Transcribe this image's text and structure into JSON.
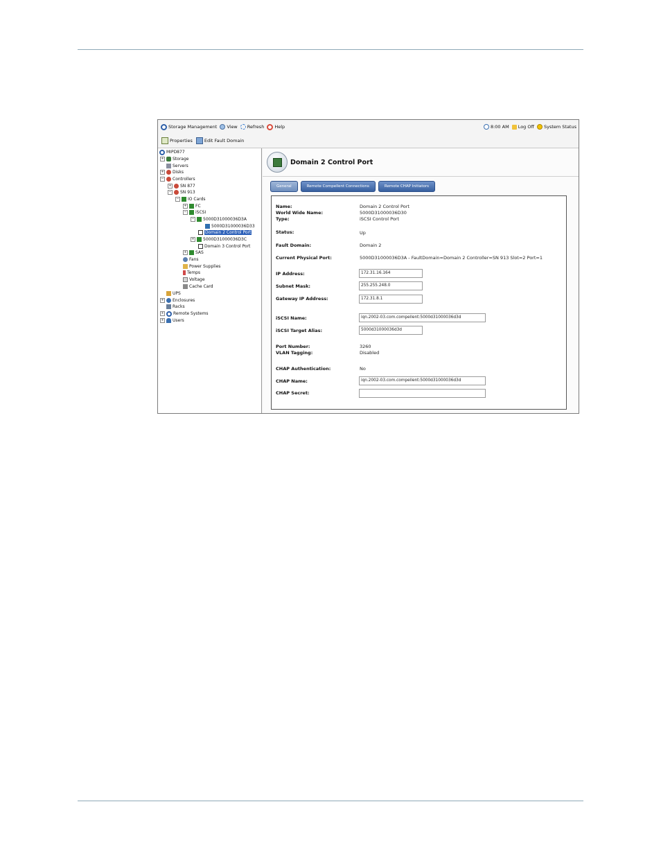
{
  "menubar": {
    "storage_management": "Storage Management",
    "view": "View",
    "refresh": "Refresh",
    "help": "Help",
    "time": "8:00 AM",
    "log_off": "Log Off",
    "system_status": "System Status"
  },
  "toolbar": {
    "properties": "Properties",
    "edit_fault_domain": "Edit Fault Domain"
  },
  "tree": {
    "root": "MIPD877",
    "storage": "Storage",
    "servers": "Servers",
    "disks": "Disks",
    "controllers": "Controllers",
    "sn877": "SN 877",
    "sn913": "SN 913",
    "io_cards": "IO Cards",
    "fc": "FC",
    "iscsi": "iSCSI",
    "port_3a": "5000D31000036D3A",
    "port_33": "5000D31000036D33",
    "domain2": "Domain 2 Control Port",
    "port_3c": "5000D31000036D3C",
    "domain3": "Domain 3 Control Port",
    "sas": "SAS",
    "fans": "Fans",
    "power_supplies": "Power Supplies",
    "temps": "Temps",
    "voltage": "Voltage",
    "cache_card": "Cache Card",
    "ups": "UPS",
    "enclosures": "Enclosures",
    "racks": "Racks",
    "remote_systems": "Remote Systems",
    "users": "Users"
  },
  "detail": {
    "title": "Domain 2 Control Port",
    "tabs": {
      "general": "General",
      "remote_connections": "Remote Compellent Connections",
      "remote_chap": "Remote CHAP Initiators"
    },
    "labels": {
      "name": "Name:",
      "wwn": "World Wide Name:",
      "type": "Type:",
      "status": "Status:",
      "fault_domain": "Fault Domain:",
      "physical_port": "Current Physical Port:",
      "ip": "IP Address:",
      "subnet": "Subnet Mask:",
      "gateway": "Gateway IP Address:",
      "iscsi_name": "iSCSI Name:",
      "iscsi_alias": "iSCSI Target Alias:",
      "port_number": "Port Number:",
      "vlan": "VLAN Tagging:",
      "chap_auth": "CHAP Authentication:",
      "chap_name": "CHAP Name:",
      "chap_secret": "CHAP Secret:"
    },
    "values": {
      "name": "Domain 2 Control Port",
      "wwn": "5000D31000036D30",
      "type": "iSCSI Control Port",
      "status": "Up",
      "fault_domain": "Domain 2",
      "physical_port": "5000D31000036D3A - FaultDomain=Domain 2 Controller=SN 913 Slot=2 Port=1",
      "ip": "172.31.16.164",
      "subnet": "255.255.248.0",
      "gateway": "172.31.8.1",
      "iscsi_name": "iqn.2002-03.com.compellent:5000d31000036d3d",
      "iscsi_alias": "5000d31000036d3d",
      "port_number": "3260",
      "vlan": "Disabled",
      "chap_auth": "No",
      "chap_name": "iqn.2002-03.com.compellent:5000d31000036d3d",
      "chap_secret": ""
    }
  },
  "colors": {
    "tab_blue": "#38609f",
    "selection_blue": "#2b5fb8",
    "rule": "#8fa8b8"
  }
}
